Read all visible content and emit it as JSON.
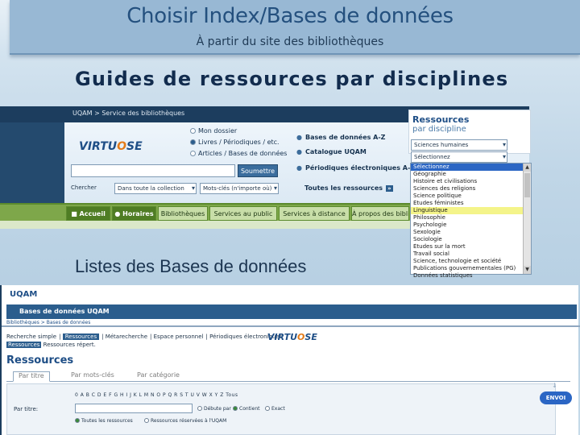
{
  "slide": {
    "title": "Choisir Index/Bases de données",
    "subtitle": "À partir du site des bibliothèques",
    "guides_heading": "Guides de ressources par disciplines",
    "listes_heading": "Listes des Bases de données"
  },
  "library_site": {
    "breadcrumb": "UQAM > Service des bibliothèques",
    "logo_pre": "VIRTU",
    "logo_o": "O",
    "logo_post": "SE",
    "search_options": [
      "Mon dossier",
      "Livres / Périodiques / etc.",
      "Articles / Bases de données"
    ],
    "submit_label": "Soumettre",
    "search_in_label": "Chercher",
    "select_scope": "Dans toute la collection",
    "select_field": "Mots-clés (n'importe où)",
    "quick_links": [
      "Bases de données A-Z",
      "Catalogue UQAM",
      "Périodiques électroniques A-Z"
    ],
    "all_resources": "Toutes les ressources",
    "all_resources_box": "»",
    "nav_tabs": [
      "Accueil",
      "Horaires",
      "Bibliothèques",
      "Services au public",
      "Services à distance",
      "À propos des biblio"
    ]
  },
  "resources_panel": {
    "title": "Ressources",
    "subtitle": "par discipline",
    "select1": "Sciences humaines",
    "select2": "Sélectionnez",
    "list_items": [
      "Sélectionnez",
      "Géographie",
      "Histoire et civilisations",
      "Sciences des religions",
      "Science politique",
      "Études féministes",
      "Linguistique",
      "Philosophie",
      "Psychologie",
      "Sexologie",
      "Sociologie",
      "Études sur la mort",
      "Travail social",
      "Science, technologie et société",
      "Publications gouvernementales (PG)",
      "Données statistiques"
    ],
    "selected_index": 0,
    "hover_index": 6
  },
  "database_site": {
    "header": "UQAM",
    "bar_title": "Bases de données UQAM",
    "breadcrumb": "Bibliothèques > Bases de données",
    "tabs": [
      "Recherche simple",
      "Ressources",
      "Métarecherche",
      "Espace personnel",
      "Périodiques électroniques"
    ],
    "active_tab": "Ressources",
    "subtabs": [
      "Ressources",
      "Ressources répert."
    ],
    "logo_pre": "VIRTU",
    "logo_o": "O",
    "logo_post": "SE",
    "resources_title": "Ressources",
    "search_tabs": [
      "Par titre",
      "Par mots-clés",
      "Par catégorie"
    ],
    "alphabet": "0 A B C D E F G H I J K L M N O P Q R S T U V W X Y Z Tous",
    "field_label": "Par titre:",
    "radio_starts": "Débute par",
    "radio_contains": "Contient",
    "radio_exact": "Exact",
    "radio_all": "Toutes les ressources",
    "radio_restricted": "Ressources réservées à l'UQAM",
    "submit_label": "ENVOI"
  }
}
